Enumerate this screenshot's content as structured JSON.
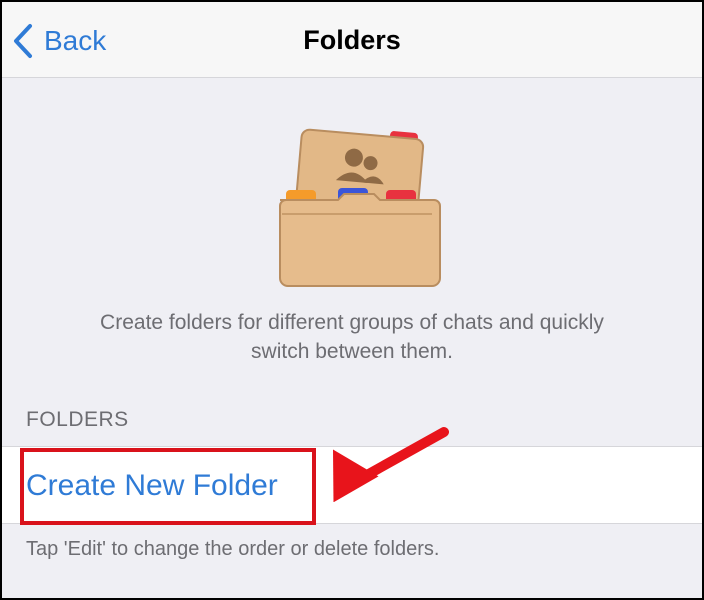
{
  "navbar": {
    "back_label": "Back",
    "title": "Folders"
  },
  "hero": {
    "icon": "folders-illustration-icon",
    "description_line1": "Create folders for different groups of chats and quickly",
    "description_line2": "switch between them."
  },
  "folders_section": {
    "header": "FOLDERS",
    "create_label": "Create New Folder",
    "footer": "Tap 'Edit' to change the order or delete folders."
  },
  "annotation": {
    "highlight_color": "#d9121b",
    "arrow_color": "#e8141b"
  },
  "colors": {
    "accent": "#2f7bd6",
    "background": "#efeff4",
    "secondary_text": "#6d6d72"
  }
}
